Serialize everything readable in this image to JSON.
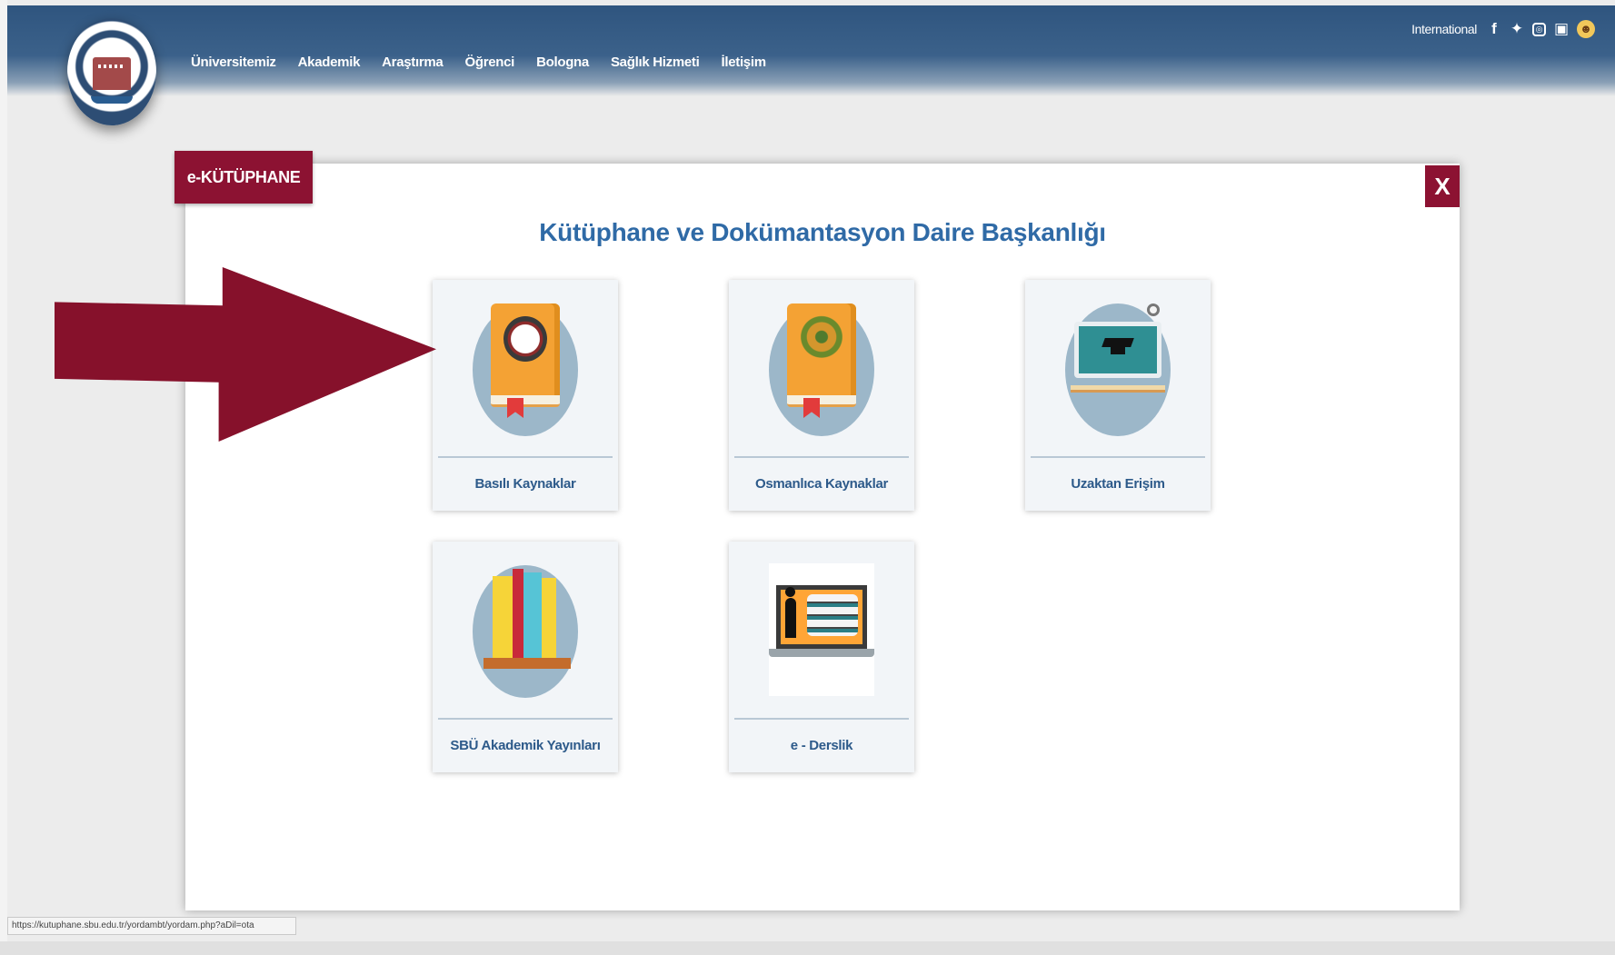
{
  "header": {
    "nav": [
      "Üniversitemiz",
      "Akademik",
      "Araştırma",
      "Öğrenci",
      "Bologna",
      "Sağlık Hizmeti",
      "İletişim"
    ],
    "international": "International",
    "social_icons": [
      "facebook-icon",
      "twitter-icon",
      "instagram-icon",
      "youtube-icon",
      "profile-icon"
    ]
  },
  "modal": {
    "tab_label": "e-KÜTÜPHANE",
    "close_label": "X",
    "title": "Kütüphane ve Dokümantasyon Daire Başkanlığı",
    "cards": [
      {
        "label": "Basılı Kaynaklar",
        "icon": "book-emblem-icon"
      },
      {
        "label": "Osmanlıca Kaynaklar",
        "icon": "ottoman-book-icon"
      },
      {
        "label": "Uzaktan Erişim",
        "icon": "graduation-screen-icon"
      },
      {
        "label": "SBÜ Akademik Yayınları",
        "icon": "books-shelf-icon"
      },
      {
        "label": "e - Derslik",
        "icon": "laptop-books-icon"
      }
    ]
  },
  "status_bar": {
    "url": "https://kutuphane.sbu.edu.tr/yordambt/yordam.php?aDil=ota"
  },
  "colors": {
    "header_blue": "#2f557f",
    "accent_maroon": "#8c1232",
    "title_blue": "#2f6aa6"
  }
}
